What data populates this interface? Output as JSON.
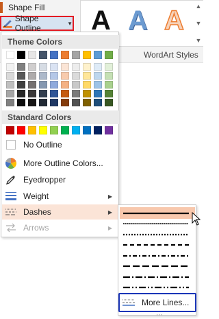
{
  "ribbon": {
    "shape_fill_label": "Shape Fill",
    "shape_outline_label": "Shape Outline",
    "wordart_styles_label": "WordArt Styles",
    "wordart_letters": [
      "A",
      "A",
      "A"
    ],
    "colors": {
      "outline_highlight": "#e31b23",
      "pressed_bg": "#d6e3f1"
    }
  },
  "menu": {
    "theme_colors_header": "Theme Colors",
    "standard_colors_header": "Standard Colors",
    "theme_top_row": [
      "#ffffff",
      "#000000",
      "#e7e6e6",
      "#44546a",
      "#4472c4",
      "#ed7d31",
      "#a5a5a5",
      "#ffc000",
      "#5b9bd5",
      "#70ad47"
    ],
    "theme_shade_columns": [
      [
        "#f2f2f2",
        "#d9d9d9",
        "#bfbfbf",
        "#a6a6a6",
        "#808080"
      ],
      [
        "#808080",
        "#595959",
        "#404040",
        "#262626",
        "#0d0d0d"
      ],
      [
        "#d0cece",
        "#aeabab",
        "#757171",
        "#3a3838",
        "#171616"
      ],
      [
        "#d6dce4",
        "#adb9ca",
        "#8497b0",
        "#333f4f",
        "#222a35"
      ],
      [
        "#dae3f3",
        "#b4c7e7",
        "#8faadc",
        "#2f5597",
        "#1f3864"
      ],
      [
        "#fbe5d6",
        "#f8cbad",
        "#f4b183",
        "#c55a11",
        "#843c0c"
      ],
      [
        "#ededed",
        "#dbdbdb",
        "#c9c9c9",
        "#7b7b7b",
        "#525252"
      ],
      [
        "#fff2cc",
        "#ffe699",
        "#ffd966",
        "#bf9000",
        "#7f6000"
      ],
      [
        "#deebf7",
        "#bdd7ee",
        "#9dc3e6",
        "#2e75b6",
        "#1f4e79"
      ],
      [
        "#e2f0d9",
        "#c5e0b4",
        "#a9d18e",
        "#548235",
        "#385723"
      ]
    ],
    "standard_colors": [
      "#c00000",
      "#ff0000",
      "#ffc000",
      "#ffff00",
      "#92d050",
      "#00b050",
      "#00b0f0",
      "#0070c0",
      "#002060",
      "#7030a0"
    ],
    "items": {
      "no_outline": "No Outline",
      "more_outline_colors": "More Outline Colors...",
      "eyedropper": "Eyedropper",
      "weight": "Weight",
      "dashes": "Dashes",
      "arrows": "Arrows"
    }
  },
  "dashes_submenu": {
    "styles": [
      "solid",
      "round-dot",
      "square-dot",
      "dash",
      "dash-dot",
      "long-dash",
      "long-dash-dot",
      "long-dash-dot-dot"
    ],
    "selected": "solid",
    "more_lines_label": "More Lines..."
  }
}
